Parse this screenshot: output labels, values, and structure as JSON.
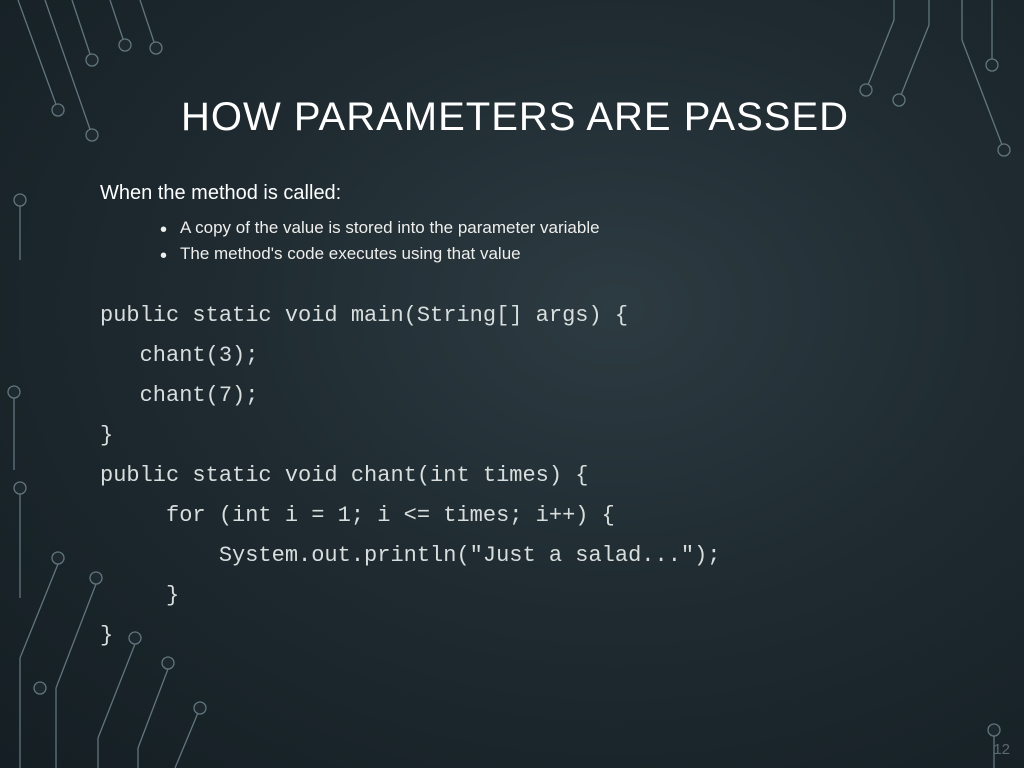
{
  "title": "HOW PARAMETERS ARE PASSED",
  "lead": "When the method is called:",
  "bullets": [
    "A copy of the value is stored into the parameter variable",
    "The method's code executes using that value"
  ],
  "code": "public static void main(String[] args) {\n   chant(3);\n   chant(7);\n}\npublic static void chant(int times) {\n     for (int i = 1; i <= times; i++) {\n         System.out.println(\"Just a salad...\");\n     }\n}",
  "page_number": "12"
}
